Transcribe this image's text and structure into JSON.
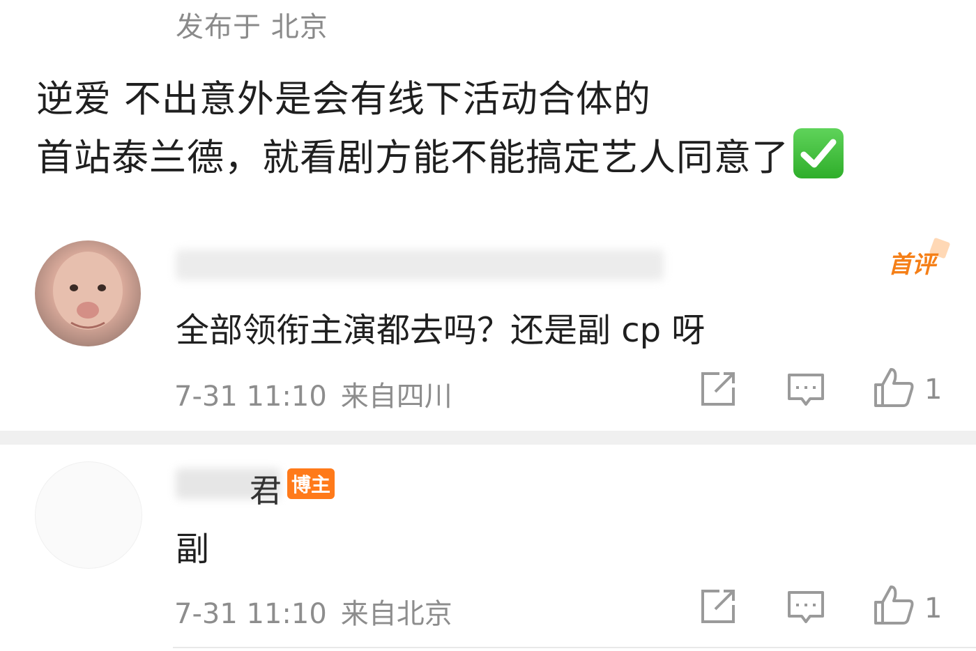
{
  "post": {
    "location_label": "发布于 北京",
    "text_line1": "逆爱 不出意外是会有线下活动合体的",
    "text_line2": "首站泰兰德，就看剧方能不能搞定艺人同意了"
  },
  "comments": [
    {
      "badge": "首评",
      "text": "全部领衔主演都去吗？还是副 cp 呀",
      "time": "7-31 11:10",
      "location": "来自四川",
      "likes": "1"
    },
    {
      "name_tail": "君",
      "badge": "博主",
      "text": "副",
      "time": "7-31 11:10",
      "location": "来自北京",
      "likes": "1"
    }
  ],
  "icons": {
    "share": "share-icon",
    "reply": "reply-icon",
    "like": "thumbs-up-icon",
    "check": "check-mark-emoji"
  },
  "colors": {
    "badge_orange": "#ff7a1a",
    "first_comment_orange": "#f57f17",
    "meta_gray": "#8d8d8d"
  }
}
